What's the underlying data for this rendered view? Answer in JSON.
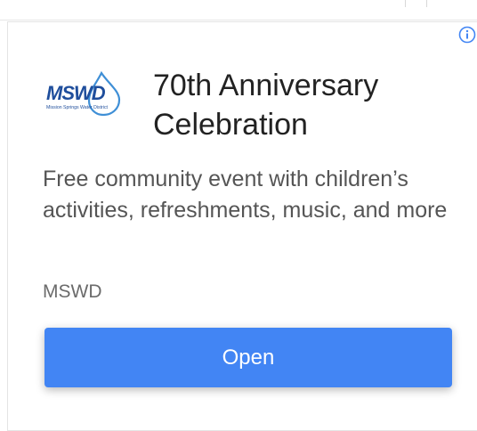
{
  "ad": {
    "headline": "70th Anniversary Celebration",
    "description": "Free community event with children’s activities, refreshments, music, and more",
    "advertiser": "MSWD",
    "cta_label": "Open",
    "logo": {
      "wordmark": "MSWD",
      "tagline": "Mission Springs Water District",
      "icon": "water-drop-icon",
      "colors": {
        "wordmark": "#1f4e9c",
        "drop": "#3f8fd6"
      }
    },
    "info_icon": "info-icon"
  },
  "colors": {
    "button": "#4285f4",
    "button_text": "#ffffff",
    "headline": "#222222",
    "body_text": "#555555",
    "info_icon": "#4285f4"
  }
}
